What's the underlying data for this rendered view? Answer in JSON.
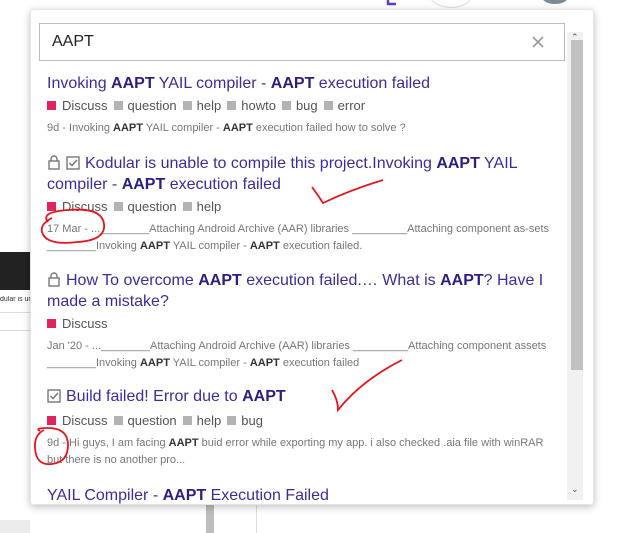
{
  "search": {
    "value": "AAPT",
    "placeholder": ""
  },
  "background": {
    "snippet": "dular is unab"
  },
  "results": [
    {
      "title_parts": [
        [
          "Invoking ",
          ""
        ],
        [
          "AAPT",
          "b"
        ],
        [
          " YAIL compiler - ",
          ""
        ],
        [
          "AAPT",
          "b"
        ],
        [
          " execution failed",
          ""
        ]
      ],
      "category": "Discuss",
      "tags": [
        "question",
        "help",
        "howto",
        "bug",
        "error"
      ],
      "blurb_parts": [
        [
          "9d - Invoking ",
          ""
        ],
        [
          "AAPT",
          "b"
        ],
        [
          " YAIL compiler - ",
          ""
        ],
        [
          "AAPT",
          "b"
        ],
        [
          " execution failed how to solve ?",
          ""
        ]
      ],
      "icons": []
    },
    {
      "title_parts": [
        [
          "Kodular is unable to compile this project.Invoking ",
          ""
        ],
        [
          "AAPT",
          "b"
        ],
        [
          " YAIL compiler - ",
          ""
        ],
        [
          "AAPT",
          "b"
        ],
        [
          " execution failed",
          ""
        ]
      ],
      "category": "Discuss",
      "tags": [
        "question",
        "help"
      ],
      "blurb_parts": [
        [
          "17 Mar - ...________Attaching Android Archive (AAR) libraries _________Attaching component as-sets ________Invoking ",
          ""
        ],
        [
          "AAPT",
          "b"
        ],
        [
          " YAIL compiler - ",
          ""
        ],
        [
          "AAPT",
          "b"
        ],
        [
          " execution failed.",
          ""
        ]
      ],
      "icons": [
        "lock-icon",
        "checkbox-icon"
      ]
    },
    {
      "title_parts": [
        [
          "How To overcome ",
          ""
        ],
        [
          "AAPT",
          "b"
        ],
        [
          " execution failed.… What is ",
          ""
        ],
        [
          "AAPT",
          "b"
        ],
        [
          "? Have I made a mistake?",
          ""
        ]
      ],
      "category": "Discuss",
      "tags": [],
      "blurb_parts": [
        [
          "Jan '20 - ...________Attaching Android Archive (AAR) libraries _________Attaching component assets ________Invoking ",
          ""
        ],
        [
          "AAPT",
          "b"
        ],
        [
          " YAIL compiler - ",
          ""
        ],
        [
          "AAPT",
          "b"
        ],
        [
          " execution failed",
          ""
        ]
      ],
      "icons": [
        "lock-icon"
      ]
    },
    {
      "title_parts": [
        [
          "Build failed! Error due to ",
          ""
        ],
        [
          "AAPT",
          "b"
        ]
      ],
      "category": "Discuss",
      "tags": [
        "question",
        "help",
        "bug"
      ],
      "blurb_parts": [
        [
          "9d - Hi guys, I am facing ",
          ""
        ],
        [
          "AAPT",
          "b"
        ],
        [
          " buid error while exporting my app. i also checked .aia file with winRAR but there is no another pro...",
          ""
        ]
      ],
      "icons": [
        "checkbox-icon"
      ]
    },
    {
      "title_parts": [
        [
          "YAIL Compiler - ",
          ""
        ],
        [
          "AAPT",
          "b"
        ],
        [
          " Execution Failed",
          ""
        ]
      ],
      "category": "",
      "tags": [],
      "blurb_parts": [],
      "icons": []
    }
  ],
  "colors": {
    "category": "#e0245e",
    "tag": "#b3b3b3",
    "link": "#3b2d9e",
    "annotation": "#e8141c"
  }
}
